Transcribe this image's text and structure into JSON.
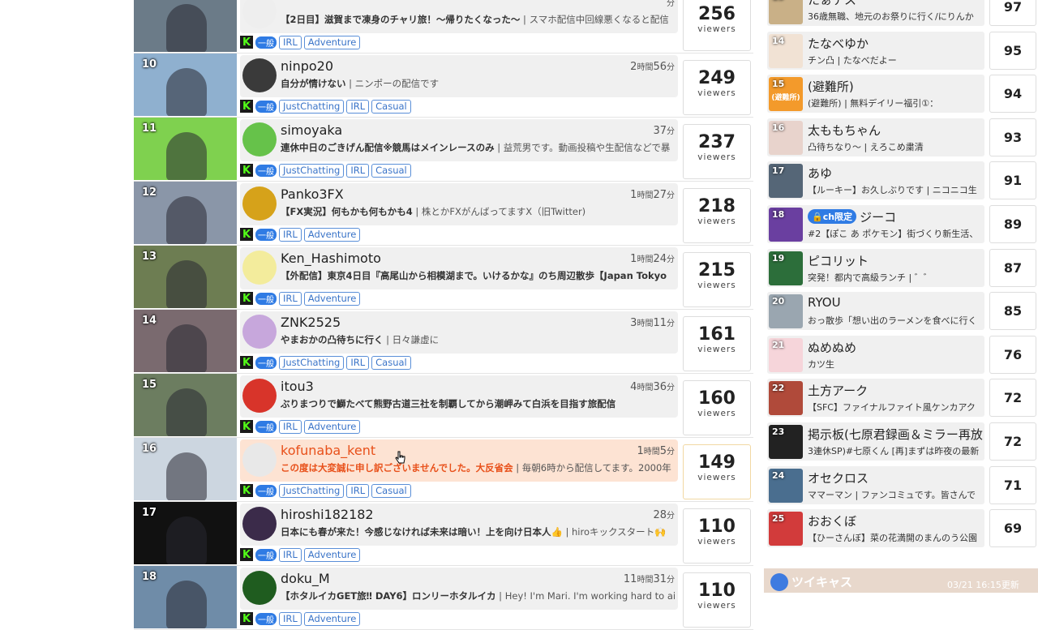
{
  "main_list": [
    {
      "rank": "",
      "name": "",
      "title": "【2日目】滋賀まで凍身のチャリ旅！〜帰りたくなった〜",
      "sub": " | スマホ配信中回線悪くなると配信",
      "dur_h": "",
      "dur_m": "",
      "tags": [
        "IRL",
        "Adventure"
      ],
      "viewers": "256",
      "thumb": "#6b7b88",
      "avatar": "#eee"
    },
    {
      "rank": "10",
      "name": "ninpo20",
      "title": "自分が情けない",
      "sub": " | ニンポーの配信です",
      "dur_h": "2",
      "dur_m": "56",
      "tags": [
        "JustChatting",
        "IRL",
        "Casual"
      ],
      "viewers": "249",
      "thumb": "#8fb0cf",
      "avatar": "#3a3a3a"
    },
    {
      "rank": "11",
      "name": "simoyaka",
      "title": "連休中日のごきげん配信※競馬はメインレースのみ",
      "sub": " | 益荒男です。動画投稿や生配信などで暴",
      "dur_h": "",
      "dur_m": "37",
      "tags": [
        "JustChatting",
        "IRL",
        "Casual"
      ],
      "viewers": "237",
      "thumb": "#7fd14f",
      "avatar": "#66c24a"
    },
    {
      "rank": "12",
      "name": "Panko3FX",
      "title": "【FX実況】何もかも何もかも4",
      "sub": " | 株とかFXがんばってますX（旧Twitter)",
      "dur_h": "1",
      "dur_m": "27",
      "tags": [
        "IRL",
        "Adventure"
      ],
      "viewers": "218",
      "thumb": "#8a96a8",
      "avatar": "#d6a21a"
    },
    {
      "rank": "13",
      "name": "Ken_Hashimoto",
      "title": "【外配信】東京4日目『高尾山から相模湖まで。いけるかな』のち周辺散歩【Japan Tokyo",
      "sub": "",
      "dur_h": "1",
      "dur_m": "24",
      "tags": [
        "IRL",
        "Adventure"
      ],
      "viewers": "215",
      "thumb": "#6d7d52",
      "avatar": "#f3ec9c"
    },
    {
      "rank": "14",
      "name": "ZNK2525",
      "title": "やまおかの凸待ちに行く",
      "sub": " | 日々謙虚に",
      "dur_h": "3",
      "dur_m": "11",
      "tags": [
        "JustChatting",
        "IRL",
        "Casual"
      ],
      "viewers": "161",
      "thumb": "#7a6a6f",
      "avatar": "#c7a7dc"
    },
    {
      "rank": "15",
      "name": "itou3",
      "title": "ぶりまつりで鰤たべて熊野古道三社を制覇してから潮岬みて白浜を目指す旅配信",
      "sub": "",
      "dur_h": "4",
      "dur_m": "36",
      "tags": [
        "IRL",
        "Adventure"
      ],
      "viewers": "160",
      "thumb": "#6c7d60",
      "avatar": "#d8342a"
    },
    {
      "rank": "16",
      "name": "kofunaba_kent",
      "title": "この度は大変誠に申し訳ございませんでした。大反省会",
      "sub": " | 毎朝6時から配信してます。2000年",
      "dur_h": "1",
      "dur_m": "5",
      "tags": [
        "JustChatting",
        "IRL",
        "Casual"
      ],
      "viewers": "149",
      "thumb": "#ccd6e0",
      "avatar": "#e8e8e8",
      "highlight": true
    },
    {
      "rank": "17",
      "name": "hiroshi182182",
      "title": "日本にも春が来た！今感じなければ未来は暗い！上を向け日本人👍",
      "sub": " | hiroキックスタート🙌",
      "dur_h": "",
      "dur_m": "28",
      "tags": [
        "IRL",
        "Adventure"
      ],
      "viewers": "110",
      "thumb": "#111111",
      "avatar": "#3b2b4a"
    },
    {
      "rank": "18",
      "name": "doku_M",
      "title": "【ホタルイカGET旅‼ DAY6】ロンリーホタルイカ",
      "sub": " | Hey! I'm Mari. I'm working hard to aim",
      "dur_h": "11",
      "dur_m": "31",
      "tags": [
        "IRL",
        "Adventure"
      ],
      "viewers": "110",
      "thumb": "#6f8ca8",
      "avatar": "#1f5c1f"
    }
  ],
  "labels": {
    "viewers": "viewers",
    "ippan": "一般",
    "hour": "時間",
    "minute": "分",
    "k": "K"
  },
  "sidebar": [
    {
      "rank": "13",
      "name": "たぁテス",
      "title": "36歳無職、地元のお祭りに行く/にりんか",
      "count": "97",
      "color": "#c9b087"
    },
    {
      "rank": "14",
      "name": "たなべゆか",
      "title": "チン凸 | たなべだよー",
      "count": "95",
      "color": "#f1e2d4"
    },
    {
      "rank": "15",
      "name": "(避難所)",
      "title": "(避難所) | 無料デイリー福引①：",
      "count": "94",
      "color": "#f39a2b",
      "avatar_text": "(避難所)"
    },
    {
      "rank": "16",
      "name": "太ももちゃん",
      "title": "凸待ちなり〜 | えろこめ粛清",
      "count": "93",
      "color": "#e8d3cc"
    },
    {
      "rank": "17",
      "name": "あゆ",
      "title": "【ルーキー】お久しぶりです | ニコニコ生",
      "count": "91",
      "color": "#556677"
    },
    {
      "rank": "18",
      "name": "ジーコ",
      "title": "#2【ぽこ あ ポケモン】街づくり新生活、",
      "count": "89",
      "color": "#6a3fa0",
      "badge": "🔒ch限定"
    },
    {
      "rank": "19",
      "name": "ピコリット",
      "title": "突発！都内で高級ランチ | ゛゛",
      "count": "87",
      "color": "#2c6e3a"
    },
    {
      "rank": "20",
      "name": "RYOU",
      "title": "おっ散歩「想い出のラーメンを食べに行く",
      "count": "85",
      "color": "#9aa6b0"
    },
    {
      "rank": "21",
      "name": "ぬめぬめ",
      "title": "カツ生",
      "count": "76",
      "color": "#f6d5da"
    },
    {
      "rank": "22",
      "name": "土方アーク",
      "title": "【SFC】ファイナルファイト風ケンカアク",
      "count": "72",
      "color": "#b04a3a"
    },
    {
      "rank": "23",
      "name": "掲示板(七原君録画＆ミラー再放",
      "title": "3連休SP)#七原くん [再]まずは昨夜の最新",
      "count": "72",
      "color": "#222222"
    },
    {
      "rank": "24",
      "name": "オセクロス",
      "title": "ママーマン | ファンコミュです。皆さんで",
      "count": "71",
      "color": "#4a6e8f"
    },
    {
      "rank": "25",
      "name": "おおくぼ",
      "title": "【ひーさんぼ】菜の花満開のまんのう公園",
      "count": "69",
      "color": "#d23b3b"
    }
  ],
  "twitcast": {
    "label": "ツイキャス",
    "time": "03/21 16:15更新"
  }
}
